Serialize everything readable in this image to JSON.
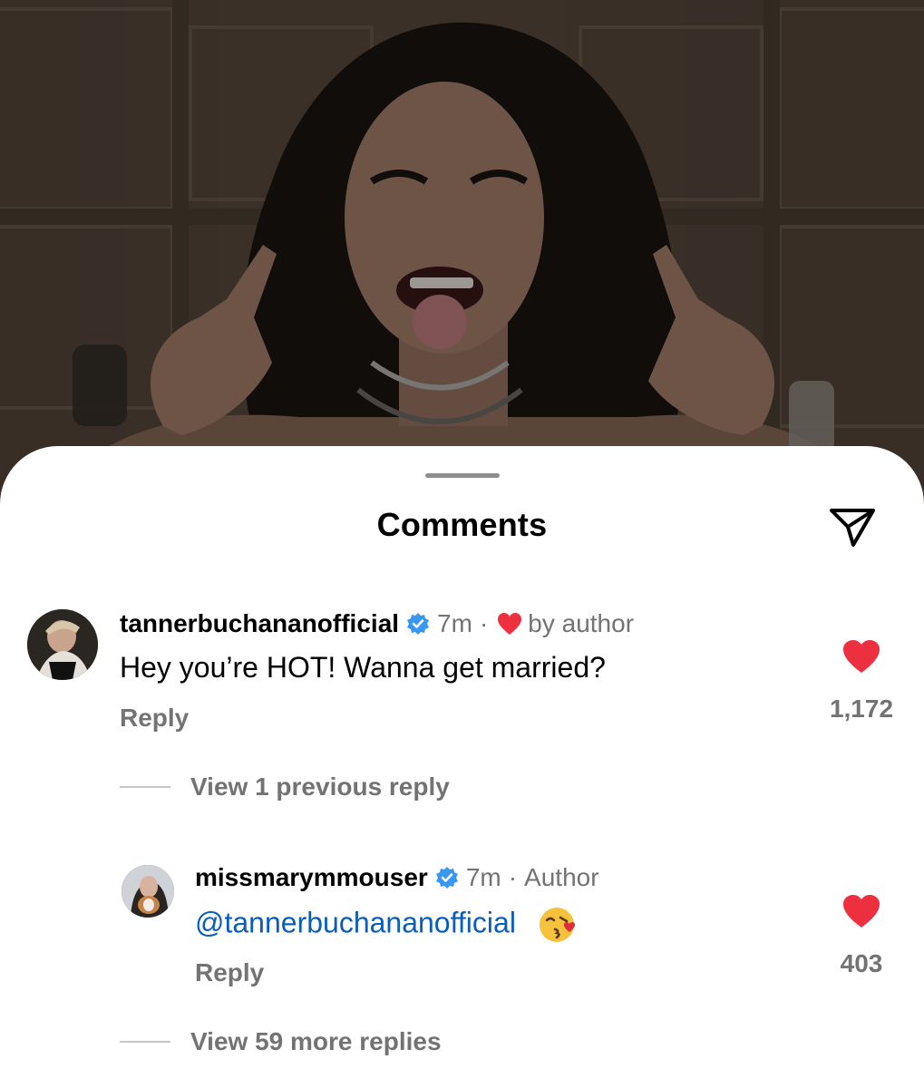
{
  "sheet": {
    "title": "Comments",
    "share_icon": "paper-plane-icon"
  },
  "comments": [
    {
      "username": "tannerbuchananofficial",
      "verified": true,
      "time": "7m",
      "separator": "·",
      "liked_by_author_label": "by author",
      "text": "Hey you’re HOT! Wanna get married?",
      "reply_label": "Reply",
      "like_count": "1,172",
      "view_replies_label": "View 1 previous reply"
    },
    {
      "username": "missmarymmouser",
      "verified": true,
      "time": "7m",
      "separator": "·",
      "author_badge": "Author",
      "mention": "@tannerbuchananofficial",
      "emoji": "face-blowing-a-kiss",
      "reply_label": "Reply",
      "like_count": "403",
      "view_replies_label": "View 59 more replies"
    }
  ],
  "colors": {
    "heart": "#ed3040",
    "verified": "#3897f0",
    "mention": "#0a5db8",
    "secondary_text": "#737373"
  }
}
